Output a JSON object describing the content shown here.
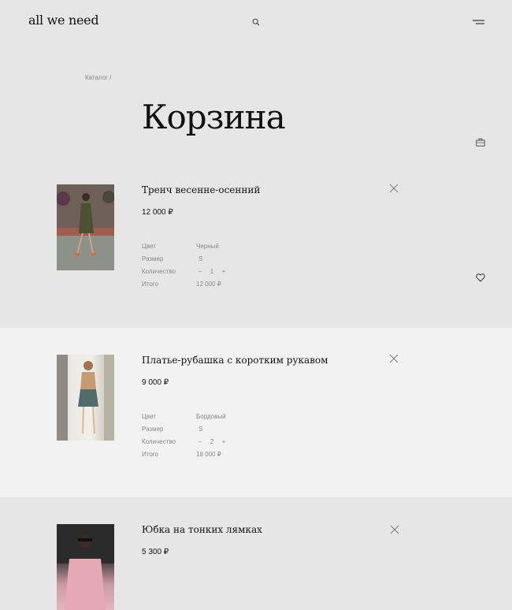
{
  "header": {
    "logo": "all we need"
  },
  "breadcrumb": "Каталог /",
  "page_title": "Корзина",
  "labels": {
    "color": "Цвет",
    "size": "Размер",
    "quantity": "Количество",
    "total": "Итого"
  },
  "qty_controls": {
    "minus": "−",
    "plus": "+"
  },
  "items": [
    {
      "name": "Тренч весенне-осенний",
      "price": "12 000 ₽",
      "color": "Черный",
      "size": "S",
      "quantity": "1",
      "total": "12 000 ₽"
    },
    {
      "name": "Платье-рубашка с коротким рукавом",
      "price": "9 000 ₽",
      "color": "Бордовый",
      "size": "S",
      "quantity": "2",
      "total": "18 000 ₽"
    },
    {
      "name": "Юбка на тонких лямках",
      "price": "5 300 ₽"
    }
  ]
}
